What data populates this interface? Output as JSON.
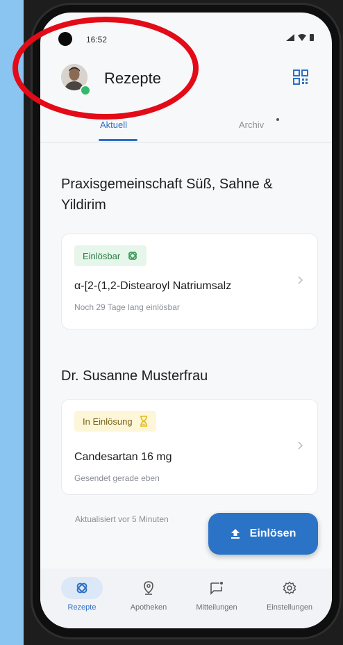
{
  "status_bar": {
    "time": "16:52"
  },
  "header": {
    "title": "Rezepte"
  },
  "tabs": [
    {
      "label": "Aktuell",
      "active": true
    },
    {
      "label": "Archiv",
      "active": false
    }
  ],
  "prescriptions": [
    {
      "practice": "Praxisgemeinschaft Süß, Sahne & Yildirim",
      "status": "Einlösbar",
      "medication": "α-[2-(1,2-Distearoyl Natriumsalz",
      "subtitle": "Noch 29 Tage lang einlösbar"
    },
    {
      "practice": "Dr. Susanne Musterfrau",
      "status": "In Einlösung",
      "medication": "Candesartan 16 mg",
      "subtitle": "Gesendet gerade eben"
    }
  ],
  "updated_text": "Aktualisiert vor 5 Minuten",
  "fab": {
    "label": "Einlösen"
  },
  "nav": [
    {
      "label": "Rezepte",
      "icon": "pill-icon",
      "active": true
    },
    {
      "label": "Apotheken",
      "icon": "location-pin-icon",
      "active": false
    },
    {
      "label": "Mitteilungen",
      "icon": "message-icon",
      "active": false
    },
    {
      "label": "Einstellungen",
      "icon": "gear-icon",
      "active": false
    }
  ],
  "colors": {
    "accent": "#2b73c6",
    "annotation": "#e30b17",
    "badge_green": "#e7f6ea",
    "badge_yellow": "#fdf6d8"
  }
}
